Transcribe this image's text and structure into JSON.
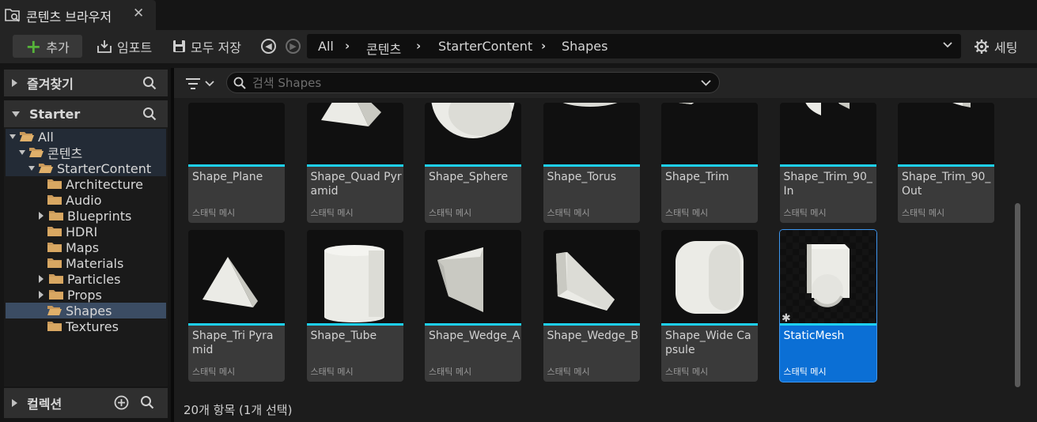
{
  "tab": {
    "title": "콘텐츠 브라우저",
    "close": "✕"
  },
  "toolbar": {
    "add_label": "추가",
    "import_label": "임포트",
    "save_all_label": "모두 저장",
    "settings_label": "세팅"
  },
  "breadcrumb": [
    "All",
    "콘텐츠",
    "StarterContent",
    "Shapes"
  ],
  "left": {
    "favorites_label": "즐겨찾기",
    "starter_label": "Starter",
    "collections_label": "컬렉션"
  },
  "tree": [
    {
      "label": "All",
      "depth": 0,
      "expanded": true
    },
    {
      "label": "콘텐츠",
      "depth": 1,
      "expanded": true
    },
    {
      "label": "StarterContent",
      "depth": 2,
      "expanded": true
    },
    {
      "label": "Architecture",
      "depth": 3
    },
    {
      "label": "Audio",
      "depth": 3
    },
    {
      "label": "Blueprints",
      "depth": 3,
      "collapsed": true
    },
    {
      "label": "HDRI",
      "depth": 3
    },
    {
      "label": "Maps",
      "depth": 3
    },
    {
      "label": "Materials",
      "depth": 3
    },
    {
      "label": "Particles",
      "depth": 3,
      "collapsed": true
    },
    {
      "label": "Props",
      "depth": 3,
      "collapsed": true
    },
    {
      "label": "Shapes",
      "depth": 3,
      "selected": true
    },
    {
      "label": "Textures",
      "depth": 3
    }
  ],
  "search": {
    "placeholder": "검색 Shapes",
    "value": ""
  },
  "assets": [
    {
      "name": "Shape_Plane",
      "type": "스태틱 메시",
      "shape": "plane"
    },
    {
      "name": "Shape_Quad Pyramid",
      "type": "스태틱 메시",
      "shape": "pyramid"
    },
    {
      "name": "Shape_Sphere",
      "type": "스태틱 메시",
      "shape": "sphere"
    },
    {
      "name": "Shape_Torus",
      "type": "스태틱 메시",
      "shape": "torus"
    },
    {
      "name": "Shape_Trim",
      "type": "스태틱 메시",
      "shape": "trim"
    },
    {
      "name": "Shape_Trim_90_ In",
      "type": "스태틱 메시",
      "shape": "trim90in"
    },
    {
      "name": "Shape_Trim_90_ Out",
      "type": "스태틱 메시",
      "shape": "trim90out"
    },
    {
      "name": "Shape_Tri Pyramid",
      "type": "스태틱 메시",
      "shape": "tripyramid"
    },
    {
      "name": "Shape_Tube",
      "type": "스태틱 메시",
      "shape": "tube"
    },
    {
      "name": "Shape_Wedge_A",
      "type": "스태틱 메시",
      "shape": "wedgea"
    },
    {
      "name": "Shape_Wedge_B",
      "type": "스태틱 메시",
      "shape": "wedgeb"
    },
    {
      "name": "Shape_Wide Capsule",
      "type": "스태틱 메시",
      "shape": "capsule"
    },
    {
      "name": "StaticMesh",
      "type": "스태틱 메시",
      "shape": "staticmesh",
      "selected": true
    }
  ],
  "status": "20개 항목 (1개 선택)",
  "colors": {
    "accent_bar": "#1ed0f0",
    "selection": "#0b6fd5",
    "add_plus": "#56b33a"
  }
}
